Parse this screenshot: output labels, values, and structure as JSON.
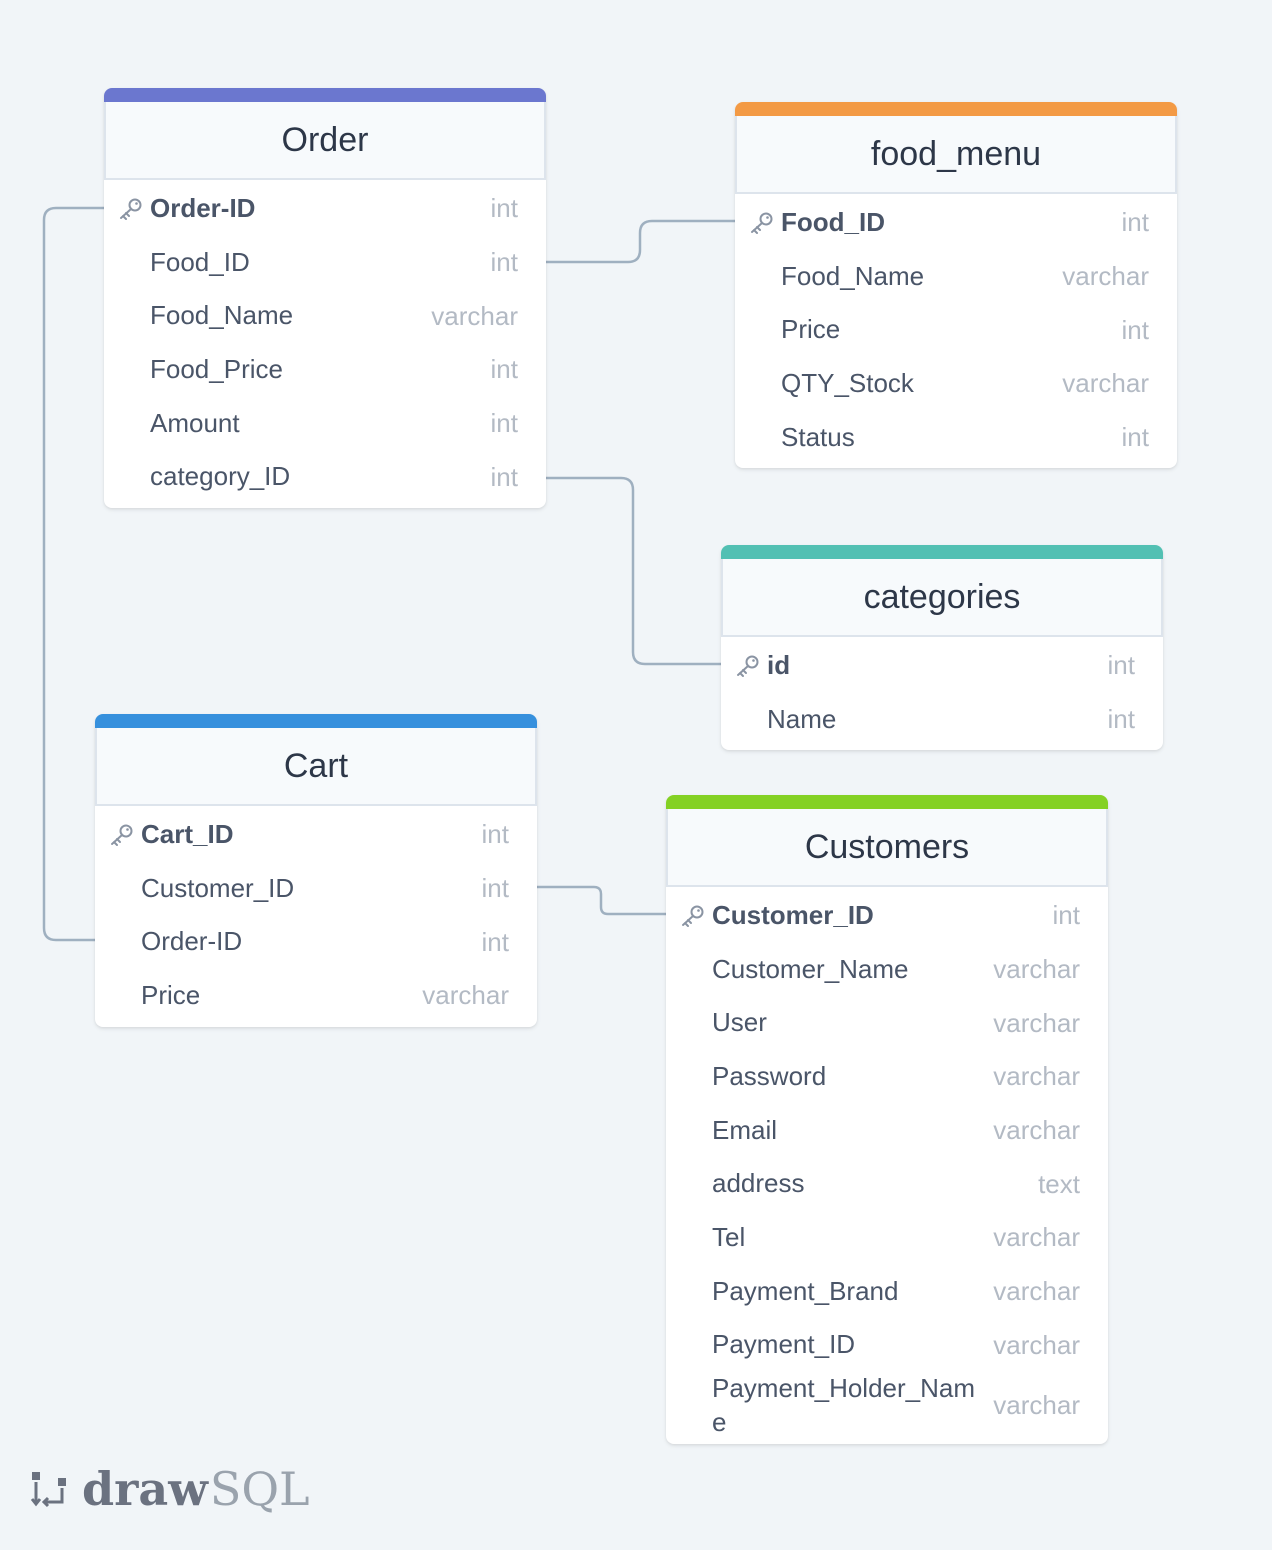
{
  "colors": {
    "background": "#f1f5f8",
    "connector": "#9fb0c0",
    "order": "#6b77cf",
    "food_menu": "#f39a45",
    "categories": "#52c0b3",
    "cart": "#3690dd",
    "customers": "#84d124"
  },
  "tables": {
    "order": {
      "title": "Order",
      "columns": [
        {
          "name": "Order-ID",
          "type": "int",
          "pk": true
        },
        {
          "name": "Food_ID",
          "type": "int"
        },
        {
          "name": "Food_Name",
          "type": "varchar"
        },
        {
          "name": "Food_Price",
          "type": "int"
        },
        {
          "name": "Amount",
          "type": "int"
        },
        {
          "name": "category_ID",
          "type": "int"
        }
      ]
    },
    "food_menu": {
      "title": "food_menu",
      "columns": [
        {
          "name": "Food_ID",
          "type": "int",
          "pk": true
        },
        {
          "name": "Food_Name",
          "type": "varchar"
        },
        {
          "name": "Price",
          "type": "int"
        },
        {
          "name": "QTY_Stock",
          "type": "varchar"
        },
        {
          "name": "Status",
          "type": "int"
        }
      ]
    },
    "categories": {
      "title": "categories",
      "columns": [
        {
          "name": "id",
          "type": "int",
          "pk": true
        },
        {
          "name": "Name",
          "type": "int"
        }
      ]
    },
    "cart": {
      "title": "Cart",
      "columns": [
        {
          "name": "Cart_ID",
          "type": "int",
          "pk": true
        },
        {
          "name": "Customer_ID",
          "type": "int"
        },
        {
          "name": "Order-ID",
          "type": "int"
        },
        {
          "name": "Price",
          "type": "varchar"
        }
      ]
    },
    "customers": {
      "title": "Customers",
      "columns": [
        {
          "name": "Customer_ID",
          "type": "int",
          "pk": true
        },
        {
          "name": "Customer_Name",
          "type": "varchar"
        },
        {
          "name": "User",
          "type": "varchar"
        },
        {
          "name": "Password",
          "type": "varchar"
        },
        {
          "name": "Email",
          "type": "varchar"
        },
        {
          "name": "address",
          "type": "text"
        },
        {
          "name": "Tel",
          "type": "varchar"
        },
        {
          "name": "Payment_Brand",
          "type": "varchar"
        },
        {
          "name": "Payment_ID",
          "type": "varchar"
        },
        {
          "name": "Payment_Holder_Name",
          "type": "varchar"
        }
      ]
    }
  },
  "relationships": [
    {
      "from": "order.Food_ID",
      "to": "food_menu.Food_ID"
    },
    {
      "from": "order.category_ID",
      "to": "categories.id"
    },
    {
      "from": "order.Order-ID",
      "to": "cart.Order-ID"
    },
    {
      "from": "cart.Customer_ID",
      "to": "customers.Customer_ID"
    }
  ],
  "logo": {
    "draw": "draw",
    "sql": "SQL"
  }
}
